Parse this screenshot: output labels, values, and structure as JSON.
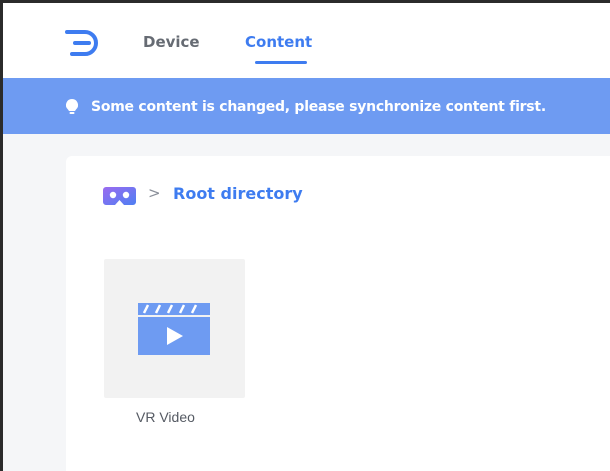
{
  "nav": {
    "tabs": [
      {
        "label": "Device"
      },
      {
        "label": "Content"
      }
    ],
    "active_tab": "Content"
  },
  "banner": {
    "message": "Some content is changed, please synchronize content first."
  },
  "breadcrumb": {
    "separator": ">",
    "root_label": "Root directory"
  },
  "items": [
    {
      "label": "VR Video",
      "icon": "video-clapperboard-icon"
    }
  ],
  "colors": {
    "accent": "#3e7cf0",
    "banner": "#6e9bf2",
    "background": "#f5f6f8",
    "tile": "#f2f2f2"
  }
}
